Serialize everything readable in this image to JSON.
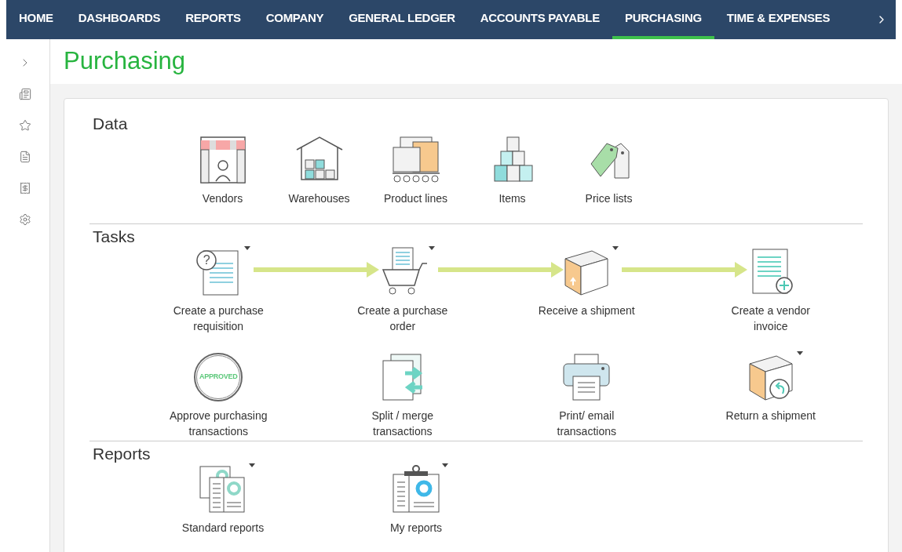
{
  "nav": {
    "items": [
      {
        "label": "HOME",
        "selected": false
      },
      {
        "label": "DASHBOARDS",
        "selected": false
      },
      {
        "label": "REPORTS",
        "selected": false
      },
      {
        "label": "COMPANY",
        "selected": false
      },
      {
        "label": "GENERAL LEDGER",
        "selected": false
      },
      {
        "label": "ACCOUNTS PAYABLE",
        "selected": false
      },
      {
        "label": "PURCHASING",
        "selected": true
      },
      {
        "label": "TIME & EXPENSES",
        "selected": false
      }
    ]
  },
  "page_title": "Purchasing",
  "sections": [
    {
      "title": "Data",
      "rows": [
        {
          "kind": "grid",
          "items": [
            {
              "label": "Vendors",
              "has_menu": false
            },
            {
              "label": "Warehouses",
              "has_menu": false
            },
            {
              "label": "Product lines",
              "has_menu": false
            },
            {
              "label": "Items",
              "has_menu": false
            },
            {
              "label": "Price lists",
              "has_menu": false
            }
          ]
        }
      ]
    },
    {
      "title": "Tasks",
      "rows": [
        {
          "kind": "flow",
          "items": [
            {
              "label": "Create a purchase requisition",
              "badge_text": "?",
              "has_menu": true
            },
            {
              "label": "Create a purchase order",
              "has_menu": true
            },
            {
              "label": "Receive a shipment",
              "has_menu": true
            },
            {
              "label": "Create a vendor invoice",
              "has_menu": false
            }
          ]
        },
        {
          "kind": "wide",
          "items": [
            {
              "label": "Approve purchasing transactions",
              "stamp_text": "APPROVED",
              "has_menu": false
            },
            {
              "label": "Split / merge transactions",
              "has_menu": false
            },
            {
              "label": "Print/ email transactions",
              "has_menu": false
            },
            {
              "label": "Return a shipment",
              "has_menu": true
            }
          ]
        }
      ]
    },
    {
      "title": "Reports",
      "rows": [
        {
          "kind": "wide",
          "items": [
            {
              "label": "Standard reports",
              "has_menu": true
            },
            {
              "label": "My reports",
              "has_menu": true
            }
          ]
        }
      ]
    }
  ]
}
